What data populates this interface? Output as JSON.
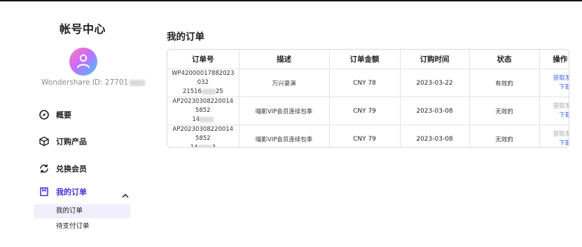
{
  "sidebar": {
    "title": "帐号中心",
    "user_id_label": "Wondershare ID: 27701",
    "nav": [
      {
        "label": "概要",
        "icon": "compass-icon"
      },
      {
        "label": "订购产品",
        "icon": "box-icon"
      },
      {
        "label": "兑换会员",
        "icon": "exchange-icon"
      },
      {
        "label": "我的订单",
        "icon": "order-icon"
      }
    ],
    "sub_items": [
      {
        "label": "我的订单"
      },
      {
        "label": "待支付订单"
      }
    ]
  },
  "main": {
    "title": "我的订单",
    "columns": [
      "订单号",
      "描述",
      "订单金额",
      "订购时间",
      "状态",
      "操作"
    ],
    "rows": [
      {
        "order_no_a": "WP42000017882023032",
        "order_no_b": "21516",
        "order_no_c": "25",
        "desc": "万兴录演",
        "amount": "CNY 78",
        "date": "2023-03-22",
        "status": "有效的",
        "action_invoice": "获取发票",
        "action_download": "下载"
      },
      {
        "order_no_a": "AP202303082200145852",
        "order_no_b": "14",
        "order_no_c": "",
        "desc": "喵影VIP会员连续包季",
        "amount": "CNY 79",
        "date": "2023-03-08",
        "status": "无效的",
        "action_invoice": "获取发票",
        "action_download": "下载"
      },
      {
        "order_no_a": "AP202303082200145852",
        "order_no_b": "14",
        "order_no_c": "3",
        "desc": "喵影VIP会员连续包季",
        "amount": "CNY 79",
        "date": "2023-03-08",
        "status": "无效的",
        "action_invoice": "获取发票",
        "action_download": "下载"
      }
    ]
  },
  "colors": {
    "accent": "#4d2bd8",
    "link": "#3a66e6",
    "disabled_link": "#a8a8a8",
    "active_bg": "#f1eefd"
  }
}
